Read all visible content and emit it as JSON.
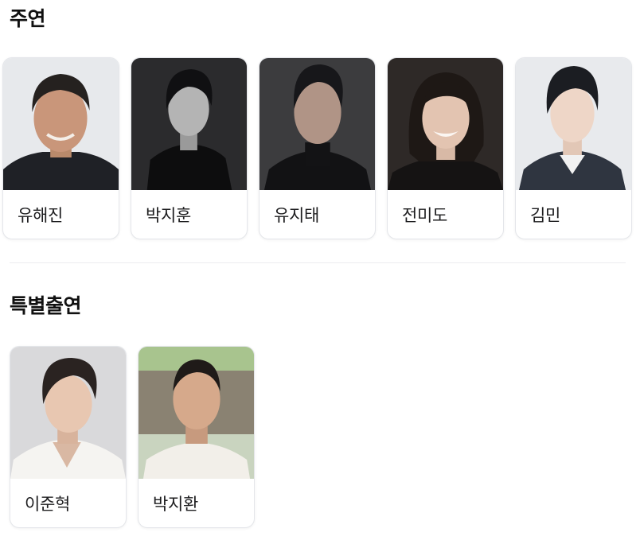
{
  "sections": [
    {
      "title": "주연",
      "cast": [
        {
          "name": "유해진"
        },
        {
          "name": "박지훈"
        },
        {
          "name": "유지태"
        },
        {
          "name": "전미도"
        },
        {
          "name": "김민"
        }
      ]
    },
    {
      "title": "특별출연",
      "cast": [
        {
          "name": "이준혁"
        },
        {
          "name": "박지환"
        }
      ]
    }
  ],
  "colors": {
    "card_border": "#e4e6ea",
    "divider": "#ececef",
    "text": "#111111"
  }
}
